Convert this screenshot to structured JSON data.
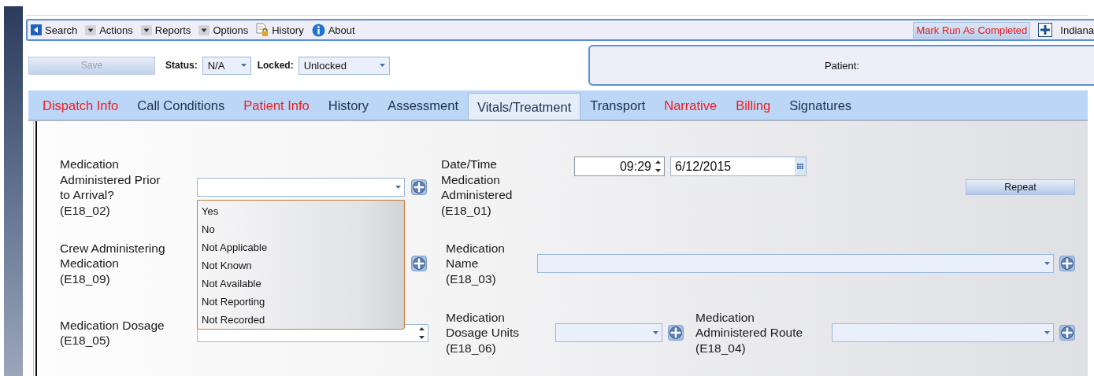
{
  "toolbar": {
    "items": [
      {
        "kind": "search",
        "label": "Search"
      },
      {
        "kind": "menu",
        "label": "Actions"
      },
      {
        "kind": "menu",
        "label": "Reports"
      },
      {
        "kind": "menu",
        "label": "Options"
      },
      {
        "kind": "history",
        "label": "History"
      },
      {
        "kind": "about",
        "label": "About"
      }
    ],
    "complete_button": "Mark Run As Completed",
    "agency": "Indiana"
  },
  "record_bar": {
    "save": {
      "label": "Save",
      "disabled": true
    },
    "status": {
      "label": "Status:",
      "value": "N/A"
    },
    "locked": {
      "label": "Locked:",
      "value": "Unlocked"
    },
    "patient": "Patient:"
  },
  "tabs": [
    {
      "label": "Dispatch Info",
      "selected": false,
      "incomplete": true
    },
    {
      "label": "Call Conditions",
      "selected": false,
      "incomplete": false
    },
    {
      "label": "Patient Info",
      "selected": false,
      "incomplete": true
    },
    {
      "label": "History",
      "selected": false,
      "incomplete": false
    },
    {
      "label": "Assessment",
      "selected": false,
      "incomplete": false
    },
    {
      "label": "Vitals/Treatment",
      "selected": true,
      "incomplete": false
    },
    {
      "label": "Transport",
      "selected": false,
      "incomplete": false
    },
    {
      "label": "Narrative",
      "selected": false,
      "incomplete": true
    },
    {
      "label": "Billing",
      "selected": false,
      "incomplete": true
    },
    {
      "label": "Signatures",
      "selected": false,
      "incomplete": false
    }
  ],
  "form": {
    "prior_to_arrival": {
      "label": "Medication\nAdministered Prior\nto Arrival?\n(E18_02)",
      "expanded": true,
      "options": [
        "Yes",
        "No",
        "Not Applicable",
        "Not Known",
        "Not Available",
        "Not Reporting",
        "Not Recorded"
      ]
    },
    "datetime": {
      "label": "Date/Time\nMedication\nAdministered\n(E18_01)",
      "time": "09:29",
      "date": "6/12/2015"
    },
    "repeat": "Repeat",
    "crew": {
      "label": "Crew Administering\nMedication\n(E18_09)"
    },
    "med_name": {
      "label": "Medication\nName\n(E18_03)"
    },
    "dosage": {
      "label": "Medication Dosage\n(E18_05)"
    },
    "units": {
      "label": "Medication\nDosage Units\n(E18_06)"
    },
    "route": {
      "label": "Medication\nAdministered Route\n(E18_04)"
    }
  }
}
